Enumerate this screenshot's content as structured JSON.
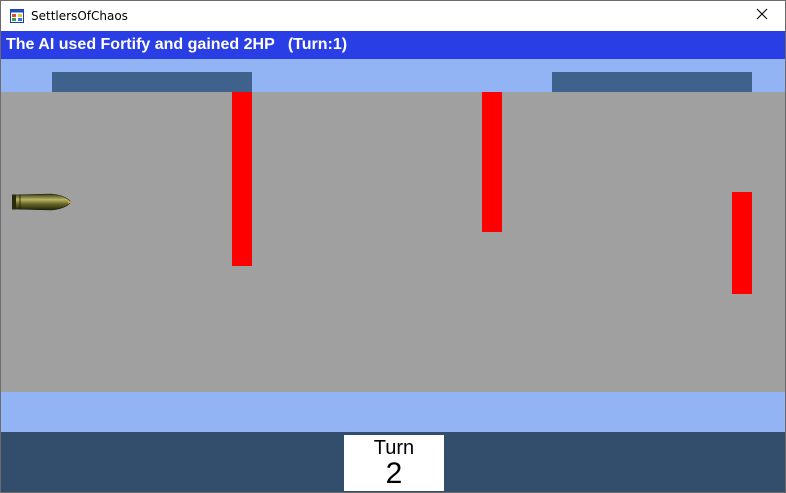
{
  "window": {
    "title": "SettlersOfChaos",
    "icons": {
      "app": "windows-form-icon",
      "close": "close-icon"
    }
  },
  "status": {
    "message": "The AI used Fortify and gained 2HP   (Turn:1)"
  },
  "turn_panel": {
    "label": "Turn",
    "value": "2"
  },
  "colors": {
    "banner": "#2a3ee6",
    "field_strip": "#92b4f4",
    "lane": "#a0a0a0",
    "fortification": "#3f628d",
    "wall": "#ff0000",
    "bottom_panel": "#334d6c"
  },
  "sprites": [
    "bullet-projectile"
  ]
}
